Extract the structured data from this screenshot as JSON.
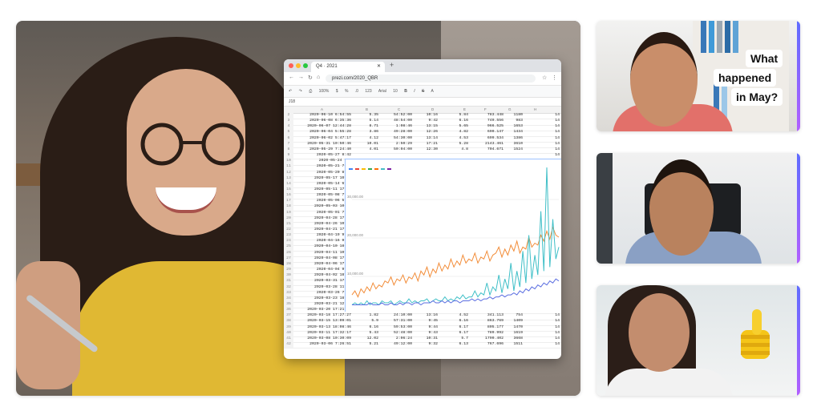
{
  "browser": {
    "tab_title": "Q4 · 2021",
    "url": "prezi.com/2020_QBR",
    "toolbar": [
      "100%",
      "$",
      "%",
      ".0",
      "123",
      "Arial",
      "10",
      "B",
      "I",
      "S",
      "A"
    ],
    "cell_ref": "J18",
    "columns": [
      "A",
      "B",
      "C",
      "D",
      "E",
      "F",
      "G",
      "H"
    ],
    "rows_top": [
      {
        "n": "2",
        "a": "2020-06-10 6:54:55",
        "b": "5.35",
        "c": "54:52:00",
        "d": "10:16",
        "e": "5.84",
        "f": "783.448",
        "g": "1180",
        "h": "14"
      },
      {
        "n": "3",
        "a": "2020-06-08 6:35:36",
        "b": "5.14",
        "c": "48:54:00",
        "d": "9:42",
        "e": "6.16",
        "f": "749.556",
        "g": "983",
        "h": "14"
      },
      {
        "n": "4",
        "a": "2020-06-07 12:44:28",
        "b": "8.71",
        "c": "1:08:46",
        "d": "13:15",
        "e": "5.65",
        "f": "966.525",
        "g": "1653",
        "h": "14"
      },
      {
        "n": "5",
        "a": "2020-06-04 5:55:28",
        "b": "3.86",
        "c": "49:28:00",
        "d": "12:26",
        "e": "4.82",
        "f": "690.147",
        "g": "1434",
        "h": "14"
      },
      {
        "n": "6",
        "a": "2020-06-02 5:47:17",
        "b": "4.12",
        "c": "54:30:00",
        "d": "13:14",
        "e": "4.53",
        "f": "699.534",
        "g": "1386",
        "h": "14"
      },
      {
        "n": "7",
        "a": "2020-05-31 10:50:46",
        "b": "10.01",
        "c": "2:50:29",
        "d": "17:21",
        "e": "5.28",
        "f": "2143.461",
        "g": "3610",
        "h": "14"
      },
      {
        "n": "8",
        "a": "2020-05-29 7:24:40",
        "b": "4.01",
        "c": "50:04:00",
        "d": "12:30",
        "e": "4.8",
        "f": "704.671",
        "g": "1524",
        "h": "14"
      },
      {
        "n": "9",
        "a": "2020-05-27 8:42",
        "b": "",
        "c": "",
        "d": "",
        "e": "",
        "f": "",
        "g": "",
        "h": "14"
      },
      {
        "n": "10",
        "a": "2020-05-24 7:0",
        "b": "",
        "c": "",
        "d": "",
        "e": "",
        "f": "",
        "g": "",
        "h": "14"
      },
      {
        "n": "11",
        "a": "2020-05-21 7:28",
        "b": "",
        "c": "",
        "d": "",
        "e": "",
        "f": "",
        "g": "",
        "h": "14"
      },
      {
        "n": "12",
        "a": "2020-05-20 8:20",
        "b": "",
        "c": "",
        "d": "",
        "e": "",
        "f": "",
        "g": "",
        "h": "14"
      },
      {
        "n": "13",
        "a": "2020-05-17 10:48",
        "b": "",
        "c": "",
        "d": "",
        "e": "",
        "f": "",
        "g": "",
        "h": "14"
      },
      {
        "n": "14",
        "a": "2020-05-14 6:23",
        "b": "",
        "c": "",
        "d": "",
        "e": "",
        "f": "",
        "g": "",
        "h": "14"
      },
      {
        "n": "15",
        "a": "2020-05-11 17:32",
        "b": "",
        "c": "",
        "d": "",
        "e": "",
        "f": "",
        "g": "",
        "h": "14"
      },
      {
        "n": "16",
        "a": "2020-05-08 7:00",
        "b": "",
        "c": "",
        "d": "",
        "e": "",
        "f": "",
        "g": "",
        "h": "14"
      },
      {
        "n": "17",
        "a": "2020-05-06 5:56",
        "b": "",
        "c": "",
        "d": "",
        "e": "",
        "f": "",
        "g": "",
        "h": "14"
      },
      {
        "n": "18",
        "a": "2020-05-03 10:36",
        "b": "",
        "c": "",
        "d": "",
        "e": "",
        "f": "",
        "g": "",
        "h": "14"
      },
      {
        "n": "19",
        "a": "2020-05-01 7:01",
        "b": "",
        "c": "",
        "d": "",
        "e": "",
        "f": "",
        "g": "",
        "h": "14"
      },
      {
        "n": "20",
        "a": "2020-04-28 17:45",
        "b": "",
        "c": "",
        "d": "",
        "e": "",
        "f": "",
        "g": "",
        "h": "14"
      },
      {
        "n": "21",
        "a": "2020-04-26 10:18",
        "b": "",
        "c": "",
        "d": "",
        "e": "",
        "f": "",
        "g": "",
        "h": "14"
      },
      {
        "n": "22",
        "a": "2020-04-21 17:29",
        "b": "",
        "c": "",
        "d": "",
        "e": "",
        "f": "",
        "g": "",
        "h": "14"
      },
      {
        "n": "23",
        "a": "2020-04-19 9:00",
        "b": "",
        "c": "",
        "d": "",
        "e": "",
        "f": "",
        "g": "",
        "h": "14"
      },
      {
        "n": "24",
        "a": "2020-04-16 9:46",
        "b": "",
        "c": "",
        "d": "",
        "e": "",
        "f": "",
        "g": "",
        "h": "14"
      },
      {
        "n": "25",
        "a": "2020-04-10 18:51",
        "b": "",
        "c": "",
        "d": "",
        "e": "",
        "f": "",
        "g": "",
        "h": "14"
      },
      {
        "n": "26",
        "a": "2020-04-11 10:29",
        "b": "",
        "c": "",
        "d": "",
        "e": "",
        "f": "",
        "g": "",
        "h": "14"
      },
      {
        "n": "27",
        "a": "2020-04-08 17:27",
        "b": "",
        "c": "",
        "d": "",
        "e": "",
        "f": "",
        "g": "",
        "h": "14"
      },
      {
        "n": "28",
        "a": "2020-04-06 17:48",
        "b": "",
        "c": "",
        "d": "",
        "e": "",
        "f": "",
        "g": "",
        "h": "14"
      },
      {
        "n": "29",
        "a": "2020-04-04 9:26",
        "b": "",
        "c": "",
        "d": "",
        "e": "",
        "f": "",
        "g": "",
        "h": "14"
      },
      {
        "n": "30",
        "a": "2020-04-02 18:56",
        "b": "",
        "c": "",
        "d": "",
        "e": "",
        "f": "",
        "g": "",
        "h": "14"
      },
      {
        "n": "31",
        "a": "2020-03-31 17:18",
        "b": "",
        "c": "",
        "d": "",
        "e": "",
        "f": "",
        "g": "",
        "h": "14"
      },
      {
        "n": "32",
        "a": "2020-03-28 11:09",
        "b": "",
        "c": "",
        "d": "",
        "e": "",
        "f": "",
        "g": "",
        "h": "14"
      },
      {
        "n": "33",
        "a": "2020-03-26 7:01",
        "b": "",
        "c": "",
        "d": "",
        "e": "",
        "f": "",
        "g": "",
        "h": "14"
      },
      {
        "n": "34",
        "a": "2020-03-23 18:00",
        "b": "",
        "c": "",
        "d": "",
        "e": "",
        "f": "",
        "g": "",
        "h": "14"
      },
      {
        "n": "35",
        "a": "2020-03-21 12:37",
        "b": "",
        "c": "",
        "d": "",
        "e": "",
        "f": "",
        "g": "",
        "h": "14"
      },
      {
        "n": "36",
        "a": "2020-03-20 17:21:57",
        "b": "3.08",
        "c": "38:59:00",
        "d": "11:41",
        "e": "5.14",
        "f": "553.254",
        "g": "1113",
        "h": "14"
      },
      {
        "n": "37",
        "a": "2020-03-18 17:27:27",
        "b": "1.82",
        "c": "24:10:00",
        "d": "13:16",
        "e": "4.52",
        "f": "341.113",
        "g": "754",
        "h": "14"
      },
      {
        "n": "38",
        "a": "2020-03-15 13:09:01",
        "b": "5.9",
        "c": "57:31:00",
        "d": "9:45",
        "e": "6.16",
        "f": "863.769",
        "g": "1409",
        "h": "14"
      },
      {
        "n": "39",
        "a": "2020-03-13 18:08:46",
        "b": "6.16",
        "c": "59:53:00",
        "d": "9:44",
        "e": "6.17",
        "f": "805.177",
        "g": "1470",
        "h": "14"
      },
      {
        "n": "40",
        "a": "2020-03-11 17:32:17",
        "b": "5.43",
        "c": "52:48:00",
        "d": "9:43",
        "e": "6.17",
        "f": "789.992",
        "g": "1619",
        "h": "14"
      },
      {
        "n": "41",
        "a": "2020-03-08 10:30:09",
        "b": "12.02",
        "c": "2:06:24",
        "d": "10:31",
        "e": "5.7",
        "f": "1790.402",
        "g": "3668",
        "h": "14"
      },
      {
        "n": "42",
        "a": "2020-03-06 7:26:51",
        "b": "5.21",
        "c": "49:12:00",
        "d": "9:32",
        "e": "6.13",
        "f": "767.696",
        "g": "1511",
        "h": "14"
      }
    ],
    "chart_y_labels": [
      "30,000.00",
      "20,000.00",
      "10,000.00"
    ]
  },
  "tile1": {
    "bubble_lines": [
      "What",
      "happened",
      "in May?"
    ]
  },
  "chart_data": {
    "type": "line",
    "title": "",
    "series": [
      {
        "name": "",
        "color": "#f28c38",
        "values": [
          6,
          8,
          5,
          9,
          7,
          10,
          8,
          12,
          9,
          11,
          10,
          13,
          12,
          15,
          11,
          14,
          13,
          16,
          12,
          15,
          14,
          17,
          13,
          18,
          16,
          20,
          15,
          19,
          17,
          22,
          18,
          21,
          19,
          24,
          20,
          23,
          21,
          26,
          22,
          24,
          23,
          27,
          22,
          25,
          24,
          28,
          23,
          26,
          27,
          30,
          25,
          29,
          26,
          31,
          28,
          33,
          27,
          30,
          29,
          35,
          30,
          32,
          31,
          36,
          33,
          38,
          34,
          40,
          36,
          35
        ]
      },
      {
        "name": "",
        "color": "#3fbfc7",
        "values": [
          1,
          2,
          1,
          2,
          1,
          3,
          1,
          2,
          2,
          1,
          3,
          2,
          2,
          3,
          1,
          2,
          3,
          2,
          2,
          4,
          2,
          3,
          2,
          3,
          3,
          4,
          2,
          3,
          4,
          3,
          3,
          5,
          3,
          4,
          3,
          5,
          4,
          6,
          4,
          5,
          5,
          8,
          5,
          7,
          6,
          12,
          6,
          10,
          8,
          16,
          7,
          14,
          9,
          22,
          8,
          18,
          10,
          28,
          12,
          36,
          14,
          26,
          16,
          48,
          18,
          70,
          20,
          44,
          24,
          30
        ]
      },
      {
        "name": "",
        "color": "#5b6ee1",
        "values": [
          1,
          1,
          1,
          1,
          1,
          1,
          2,
          1,
          1,
          1,
          2,
          1,
          1,
          2,
          1,
          1,
          2,
          1,
          2,
          2,
          1,
          2,
          2,
          1,
          2,
          2,
          2,
          3,
          2,
          2,
          3,
          2,
          3,
          2,
          3,
          3,
          2,
          3,
          3,
          3,
          4,
          3,
          4,
          3,
          4,
          4,
          5,
          4,
          5,
          5,
          6,
          5,
          6,
          6,
          7,
          6,
          8,
          7,
          9,
          8,
          10,
          9,
          11,
          10,
          12,
          11,
          13,
          12,
          14,
          13
        ]
      }
    ],
    "ylim": [
      0,
      70
    ]
  }
}
